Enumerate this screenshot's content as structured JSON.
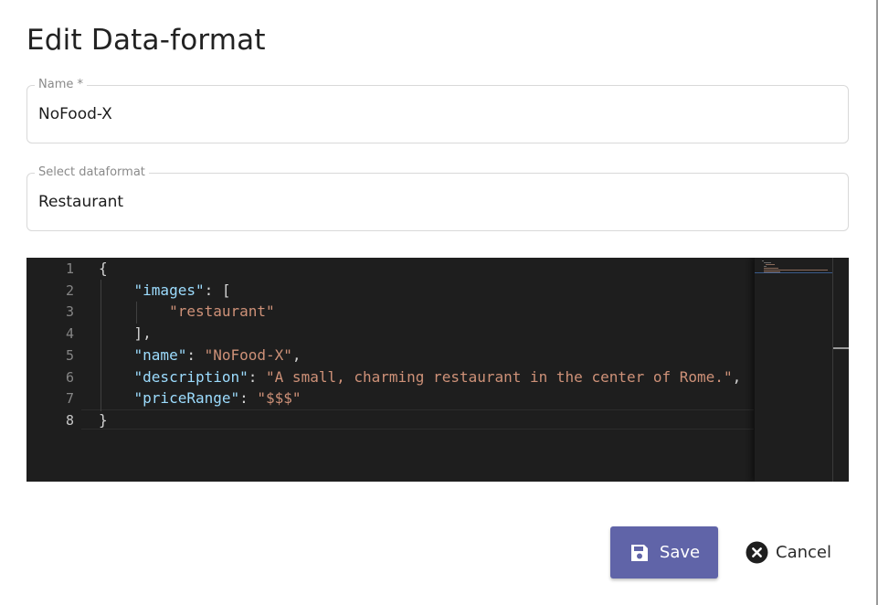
{
  "dialog": {
    "title": "Edit Data-format"
  },
  "name_field": {
    "label": "Name *",
    "value": "NoFood-X"
  },
  "dataformat_field": {
    "label": "Select dataformat",
    "value": "Restaurant"
  },
  "editor": {
    "line_numbers": [
      "1",
      "2",
      "3",
      "4",
      "5",
      "6",
      "7",
      "8"
    ],
    "active_line": 8,
    "lines": [
      [
        {
          "t": "{",
          "c": "p"
        }
      ],
      [
        {
          "t": "    ",
          "c": "p"
        },
        {
          "t": "\"images\"",
          "c": "k"
        },
        {
          "t": ": [",
          "c": "p"
        }
      ],
      [
        {
          "t": "        ",
          "c": "p"
        },
        {
          "t": "\"restaurant\"",
          "c": "s"
        }
      ],
      [
        {
          "t": "    ],",
          "c": "p"
        }
      ],
      [
        {
          "t": "    ",
          "c": "p"
        },
        {
          "t": "\"name\"",
          "c": "k"
        },
        {
          "t": ": ",
          "c": "p"
        },
        {
          "t": "\"NoFood-X\"",
          "c": "s"
        },
        {
          "t": ",",
          "c": "p"
        }
      ],
      [
        {
          "t": "    ",
          "c": "p"
        },
        {
          "t": "\"description\"",
          "c": "k"
        },
        {
          "t": ": ",
          "c": "p"
        },
        {
          "t": "\"A small, charming restaurant in the center of Rome.\"",
          "c": "s"
        },
        {
          "t": ",",
          "c": "p"
        }
      ],
      [
        {
          "t": "    ",
          "c": "p"
        },
        {
          "t": "\"priceRange\"",
          "c": "k"
        },
        {
          "t": ": ",
          "c": "p"
        },
        {
          "t": "\"$$$\"",
          "c": "s"
        }
      ],
      [
        {
          "t": "}",
          "c": "p"
        }
      ]
    ]
  },
  "actions": {
    "save_label": "Save",
    "save_icon": "floppy-disk-icon",
    "cancel_label": "Cancel",
    "cancel_icon": "close-circle-icon"
  },
  "colors": {
    "primary": "#6064a8",
    "editor_bg": "#1e1e1e",
    "json_key": "#9cdcfe",
    "json_string": "#ce9178"
  }
}
